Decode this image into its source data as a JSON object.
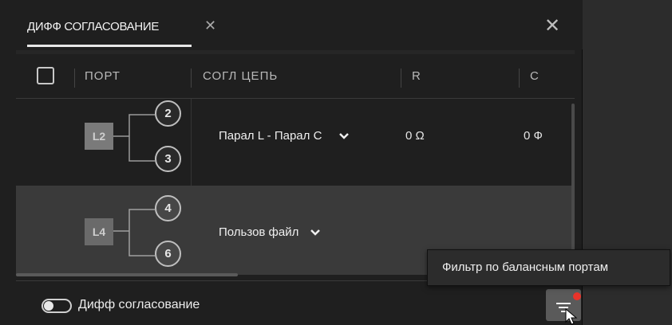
{
  "tab": {
    "label": "ДИФФ СОГЛАСОВАНИЕ",
    "close_glyph": "✕"
  },
  "panel": {
    "close_glyph": "✕"
  },
  "table": {
    "columns": [
      "ПОРТ",
      "СОГЛ ЦЕПЬ",
      "R",
      "C"
    ],
    "rows": [
      {
        "logical_port": "L2",
        "ports": [
          "2",
          "3"
        ],
        "match_circuit": "Парал L - Парал C",
        "r": "0 Ω",
        "c": "0 Ф",
        "selected": false
      },
      {
        "logical_port": "L4",
        "ports": [
          "4",
          "6"
        ],
        "match_circuit": "Пользов файл",
        "r": "",
        "c": "",
        "selected": true
      }
    ]
  },
  "footer": {
    "toggle_label": "Дифф согласование",
    "toggle_on": false
  },
  "tooltip": {
    "text": "Фильтр по балансным портам"
  },
  "icons": {
    "filter": "filter-icon",
    "chevron": "chevron-down-icon",
    "cursor": "mouse-pointer-icon"
  },
  "colors": {
    "accent_dot": "#e8332a",
    "selected_row": "#3a3a3a",
    "panel_bg": "#1f1f1f"
  }
}
